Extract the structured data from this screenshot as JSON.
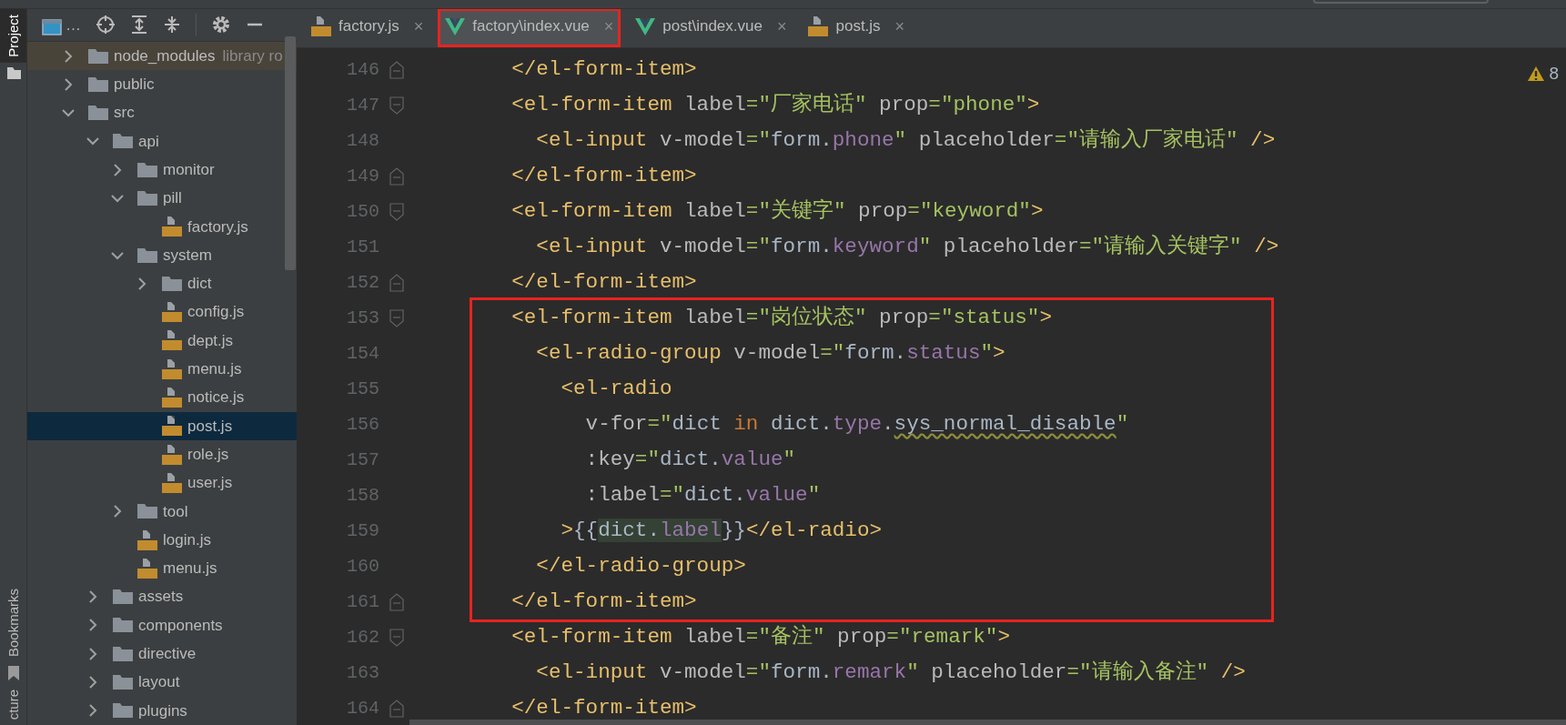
{
  "side_tabs": [
    {
      "label": "Project",
      "selected": true
    },
    {
      "label": "Bookmarks",
      "selected": false
    },
    {
      "label": "cture",
      "selected": false
    }
  ],
  "project_toolbar": {
    "view_label": "…"
  },
  "editor_tabs": [
    {
      "label": "factory.js",
      "kind": "js",
      "close": "×",
      "selected": false,
      "outlined": false
    },
    {
      "label": "factory\\index.vue",
      "kind": "vue",
      "close": "×",
      "selected": true,
      "outlined": true
    },
    {
      "label": "post\\index.vue",
      "kind": "vue",
      "close": "×",
      "selected": false,
      "outlined": false
    },
    {
      "label": "post.js",
      "kind": "js",
      "close": "×",
      "selected": false,
      "outlined": false
    }
  ],
  "tree": [
    {
      "label": "node_modules",
      "kind": "folder",
      "note": "library ro",
      "expanded": false,
      "library": true,
      "selected": false
    },
    {
      "label": "public",
      "kind": "folder",
      "expanded": false,
      "library": false,
      "selected": false
    },
    {
      "label": "src",
      "kind": "folder",
      "expanded": true,
      "library": false,
      "selected": false,
      "children": [
        {
          "label": "api",
          "kind": "folder",
          "expanded": true,
          "library": false,
          "selected": false,
          "children": [
            {
              "label": "monitor",
              "kind": "folder",
              "expanded": false,
              "library": false,
              "selected": false
            },
            {
              "label": "pill",
              "kind": "folder",
              "expanded": true,
              "library": false,
              "selected": false,
              "children": [
                {
                  "label": "factory.js",
                  "kind": "js",
                  "library": false,
                  "selected": false
                }
              ]
            },
            {
              "label": "system",
              "kind": "folder",
              "expanded": true,
              "library": false,
              "selected": false,
              "children": [
                {
                  "label": "dict",
                  "kind": "folder",
                  "expanded": false,
                  "library": false,
                  "selected": false
                },
                {
                  "label": "config.js",
                  "kind": "js",
                  "library": false,
                  "selected": false
                },
                {
                  "label": "dept.js",
                  "kind": "js",
                  "library": false,
                  "selected": false
                },
                {
                  "label": "menu.js",
                  "kind": "js",
                  "library": false,
                  "selected": false
                },
                {
                  "label": "notice.js",
                  "kind": "js",
                  "library": false,
                  "selected": false
                },
                {
                  "label": "post.js",
                  "kind": "js",
                  "library": false,
                  "selected": true
                },
                {
                  "label": "role.js",
                  "kind": "js",
                  "library": false,
                  "selected": false
                },
                {
                  "label": "user.js",
                  "kind": "js",
                  "library": false,
                  "selected": false
                }
              ]
            },
            {
              "label": "tool",
              "kind": "folder",
              "expanded": false,
              "library": false,
              "selected": false
            },
            {
              "label": "login.js",
              "kind": "js",
              "library": false,
              "selected": false
            },
            {
              "label": "menu.js",
              "kind": "js",
              "library": false,
              "selected": false
            }
          ]
        },
        {
          "label": "assets",
          "kind": "folder",
          "expanded": false,
          "library": false,
          "selected": false
        },
        {
          "label": "components",
          "kind": "folder",
          "expanded": false,
          "library": false,
          "selected": false
        },
        {
          "label": "directive",
          "kind": "folder",
          "expanded": false,
          "library": false,
          "selected": false
        },
        {
          "label": "layout",
          "kind": "folder",
          "expanded": false,
          "library": false,
          "selected": false
        },
        {
          "label": "plugins",
          "kind": "folder",
          "expanded": false,
          "library": false,
          "selected": false
        }
      ]
    }
  ],
  "warnings": {
    "count": "8"
  },
  "code": [
    {
      "number": "146",
      "kind": "fold_end",
      "boxed": false,
      "tokens": [
        {
          "kind": "tag",
          "text": "    </el-form-item>"
        }
      ]
    },
    {
      "number": "147",
      "kind": "fold_start",
      "boxed": false,
      "tokens": [
        {
          "kind": "tag",
          "text": "    <el-form-item"
        },
        {
          "kind": "attr",
          "text": " label"
        },
        {
          "kind": "string",
          "text": "=\"厂家电话\""
        },
        {
          "kind": "attr",
          "text": " prop"
        },
        {
          "kind": "string",
          "text": "=\"phone\""
        },
        {
          "kind": "tag",
          "text": ">"
        }
      ]
    },
    {
      "number": "148",
      "kind": "plain",
      "boxed": false,
      "tokens": [
        {
          "kind": "tag",
          "text": "      <el-input"
        },
        {
          "kind": "attr",
          "text": " v-model"
        },
        {
          "kind": "string",
          "text": "=\""
        },
        {
          "kind": "plain",
          "text": "form."
        },
        {
          "kind": "prop",
          "text": "phone"
        },
        {
          "kind": "string",
          "text": "\""
        },
        {
          "kind": "attr",
          "text": " placeholder"
        },
        {
          "kind": "string",
          "text": "=\"请输入厂家电话\""
        },
        {
          "kind": "tag",
          "text": " />"
        }
      ]
    },
    {
      "number": "149",
      "kind": "fold_end",
      "boxed": false,
      "tokens": [
        {
          "kind": "tag",
          "text": "    </el-form-item>"
        }
      ]
    },
    {
      "number": "150",
      "kind": "fold_start",
      "boxed": false,
      "tokens": [
        {
          "kind": "tag",
          "text": "    <el-form-item"
        },
        {
          "kind": "attr",
          "text": " label"
        },
        {
          "kind": "string",
          "text": "=\"关键字\""
        },
        {
          "kind": "attr",
          "text": " prop"
        },
        {
          "kind": "string",
          "text": "=\"keyword\""
        },
        {
          "kind": "tag",
          "text": ">"
        }
      ]
    },
    {
      "number": "151",
      "kind": "plain",
      "boxed": false,
      "tokens": [
        {
          "kind": "tag",
          "text": "      <el-input"
        },
        {
          "kind": "attr",
          "text": " v-model"
        },
        {
          "kind": "string",
          "text": "=\""
        },
        {
          "kind": "plain",
          "text": "form."
        },
        {
          "kind": "prop",
          "text": "keyword"
        },
        {
          "kind": "string",
          "text": "\""
        },
        {
          "kind": "attr",
          "text": " placeholder"
        },
        {
          "kind": "string",
          "text": "=\"请输入关键字\""
        },
        {
          "kind": "tag",
          "text": " />"
        }
      ]
    },
    {
      "number": "152",
      "kind": "fold_end",
      "boxed": false,
      "tokens": [
        {
          "kind": "tag",
          "text": "    </el-form-item>"
        }
      ]
    },
    {
      "number": "153",
      "kind": "fold_start",
      "boxed": true,
      "tokens": [
        {
          "kind": "tag",
          "text": "    <el-form-item"
        },
        {
          "kind": "attr",
          "text": " label"
        },
        {
          "kind": "string",
          "text": "=\"岗位状态\""
        },
        {
          "kind": "attr",
          "text": " prop"
        },
        {
          "kind": "string",
          "text": "=\"status\""
        },
        {
          "kind": "tag",
          "text": ">"
        }
      ]
    },
    {
      "number": "154",
      "kind": "plain",
      "boxed": true,
      "tokens": [
        {
          "kind": "tag",
          "text": "      <el-radio-group"
        },
        {
          "kind": "attr",
          "text": " v-model"
        },
        {
          "kind": "string",
          "text": "=\""
        },
        {
          "kind": "plain",
          "text": "form."
        },
        {
          "kind": "prop",
          "text": "status"
        },
        {
          "kind": "string",
          "text": "\""
        },
        {
          "kind": "tag",
          "text": ">"
        }
      ]
    },
    {
      "number": "155",
      "kind": "plain",
      "boxed": true,
      "tokens": [
        {
          "kind": "tag",
          "text": "        <el-radio"
        }
      ]
    },
    {
      "number": "156",
      "kind": "plain",
      "boxed": true,
      "tokens": [
        {
          "kind": "attr",
          "text": "          v-for"
        },
        {
          "kind": "string",
          "text": "=\""
        },
        {
          "kind": "plain",
          "text": "dict "
        },
        {
          "kind": "keyword",
          "text": "in"
        },
        {
          "kind": "plain",
          "text": " dict."
        },
        {
          "kind": "prop",
          "text": "type"
        },
        {
          "kind": "plain",
          "text": "."
        },
        {
          "kind": "typo",
          "text": "sys_normal_disable"
        },
        {
          "kind": "string",
          "text": "\""
        }
      ]
    },
    {
      "number": "157",
      "kind": "plain",
      "boxed": true,
      "tokens": [
        {
          "kind": "attr",
          "text": "          :key"
        },
        {
          "kind": "string",
          "text": "=\""
        },
        {
          "kind": "plain",
          "text": "dict."
        },
        {
          "kind": "prop",
          "text": "value"
        },
        {
          "kind": "string",
          "text": "\""
        }
      ]
    },
    {
      "number": "158",
      "kind": "plain",
      "boxed": true,
      "tokens": [
        {
          "kind": "attr",
          "text": "          :label"
        },
        {
          "kind": "string",
          "text": "=\""
        },
        {
          "kind": "plain",
          "text": "dict."
        },
        {
          "kind": "prop",
          "text": "value"
        },
        {
          "kind": "string",
          "text": "\""
        }
      ]
    },
    {
      "number": "159",
      "kind": "plain",
      "boxed": true,
      "tokens": [
        {
          "kind": "tag",
          "text": "        >"
        },
        {
          "kind": "plain",
          "text": "{{"
        },
        {
          "kind": "plain_hl",
          "text": "dict."
        },
        {
          "kind": "prop_hl",
          "text": "label"
        },
        {
          "kind": "plain",
          "text": "}}"
        },
        {
          "kind": "tag",
          "text": "</el-radio>"
        }
      ]
    },
    {
      "number": "160",
      "kind": "plain",
      "boxed": true,
      "tokens": [
        {
          "kind": "tag",
          "text": "      </el-radio-group>"
        }
      ]
    },
    {
      "number": "161",
      "kind": "fold_end",
      "boxed": true,
      "tokens": [
        {
          "kind": "tag",
          "text": "    </el-form-item>"
        }
      ]
    },
    {
      "number": "162",
      "kind": "fold_start",
      "boxed": false,
      "tokens": [
        {
          "kind": "tag",
          "text": "    <el-form-item"
        },
        {
          "kind": "attr",
          "text": " label"
        },
        {
          "kind": "string",
          "text": "=\"备注\""
        },
        {
          "kind": "attr",
          "text": " prop"
        },
        {
          "kind": "string",
          "text": "=\"remark\""
        },
        {
          "kind": "tag",
          "text": ">"
        }
      ]
    },
    {
      "number": "163",
      "kind": "plain",
      "boxed": false,
      "tokens": [
        {
          "kind": "tag",
          "text": "      <el-input"
        },
        {
          "kind": "attr",
          "text": " v-model"
        },
        {
          "kind": "string",
          "text": "=\""
        },
        {
          "kind": "plain",
          "text": "form."
        },
        {
          "kind": "prop",
          "text": "remark"
        },
        {
          "kind": "string",
          "text": "\""
        },
        {
          "kind": "attr",
          "text": " placeholder"
        },
        {
          "kind": "string",
          "text": "=\"请输入备注\""
        },
        {
          "kind": "tag",
          "text": " />"
        }
      ]
    },
    {
      "number": "164",
      "kind": "fold_end",
      "boxed": false,
      "tokens": [
        {
          "kind": "tag",
          "text": "    </el-form-item>"
        }
      ]
    }
  ]
}
